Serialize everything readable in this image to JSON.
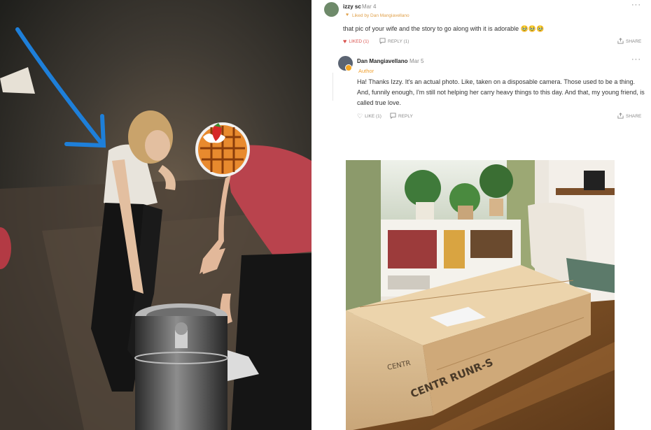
{
  "comments": [
    {
      "author": "izzy sc",
      "date": "Mar 4",
      "liked_by": "Liked by Dan Mangiavellano",
      "body": "that pic of your wife and the story to go along with it is adorable 🥹🥹🥹",
      "like_label": "LIKED (1)",
      "reply_label": "REPLY (1)",
      "share_label": "SHARE",
      "more_label": "···"
    },
    {
      "author": "Dan Mangiavellano",
      "date": "Mar 5",
      "role": "Author",
      "body": "Ha! Thanks Izzy. It's an actual photo. Like, taken on a disposable camera. Those used to be a thing. And, funnily enough, I'm still not helping her carry heavy things to this day. And that, my young friend, is called true love.",
      "like_label": "LIKE (1)",
      "reply_label": "REPLY",
      "share_label": "SHARE",
      "more_label": "···"
    }
  ],
  "box_label": {
    "brand": "CENTR",
    "model": "CENTR RUNR-S"
  },
  "colors": {
    "accent": "#e0a04a",
    "liked": "#d9534f",
    "muted": "#8a8a8a",
    "arrow": "#1e7fd9"
  },
  "icons": [
    "heart-icon",
    "reply-bubble-icon",
    "share-icon",
    "more-icon",
    "waffle-emoji-icon",
    "arrow-annotation"
  ]
}
